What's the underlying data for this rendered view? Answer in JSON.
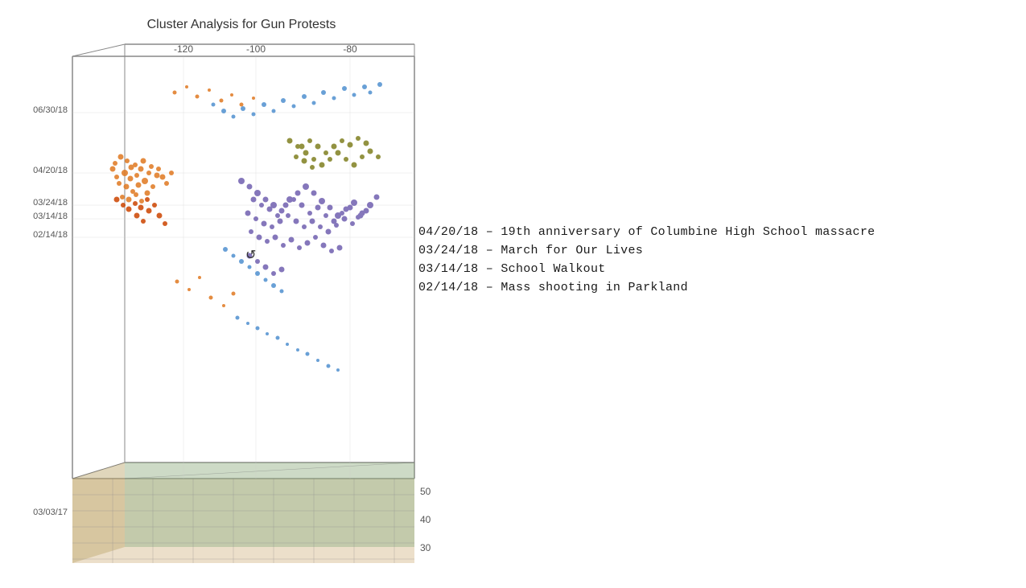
{
  "chart": {
    "title": "Cluster Analysis for Gun Protests",
    "xAxis": {
      "labels": [
        "-120",
        "-100",
        "-80"
      ]
    },
    "yAxis": {
      "labels": [
        "06/30/18",
        "04/20/18",
        "03/24/18",
        "03/14/18",
        "02/14/18",
        "03/03/17"
      ]
    },
    "zAxis": {
      "labels": [
        "50",
        "40",
        "30"
      ]
    }
  },
  "legend": {
    "items": [
      {
        "date": "04/20/18",
        "dash": "–",
        "description": "19th anniversary of Columbine High School massacre"
      },
      {
        "date": "03/24/18",
        "dash": "–",
        "description": "March for Our Lives"
      },
      {
        "date": "03/14/18",
        "dash": "–",
        "description": "School Walkout"
      },
      {
        "date": "02/14/18",
        "dash": "–",
        "description": "Mass shooting in Parkland"
      }
    ]
  }
}
